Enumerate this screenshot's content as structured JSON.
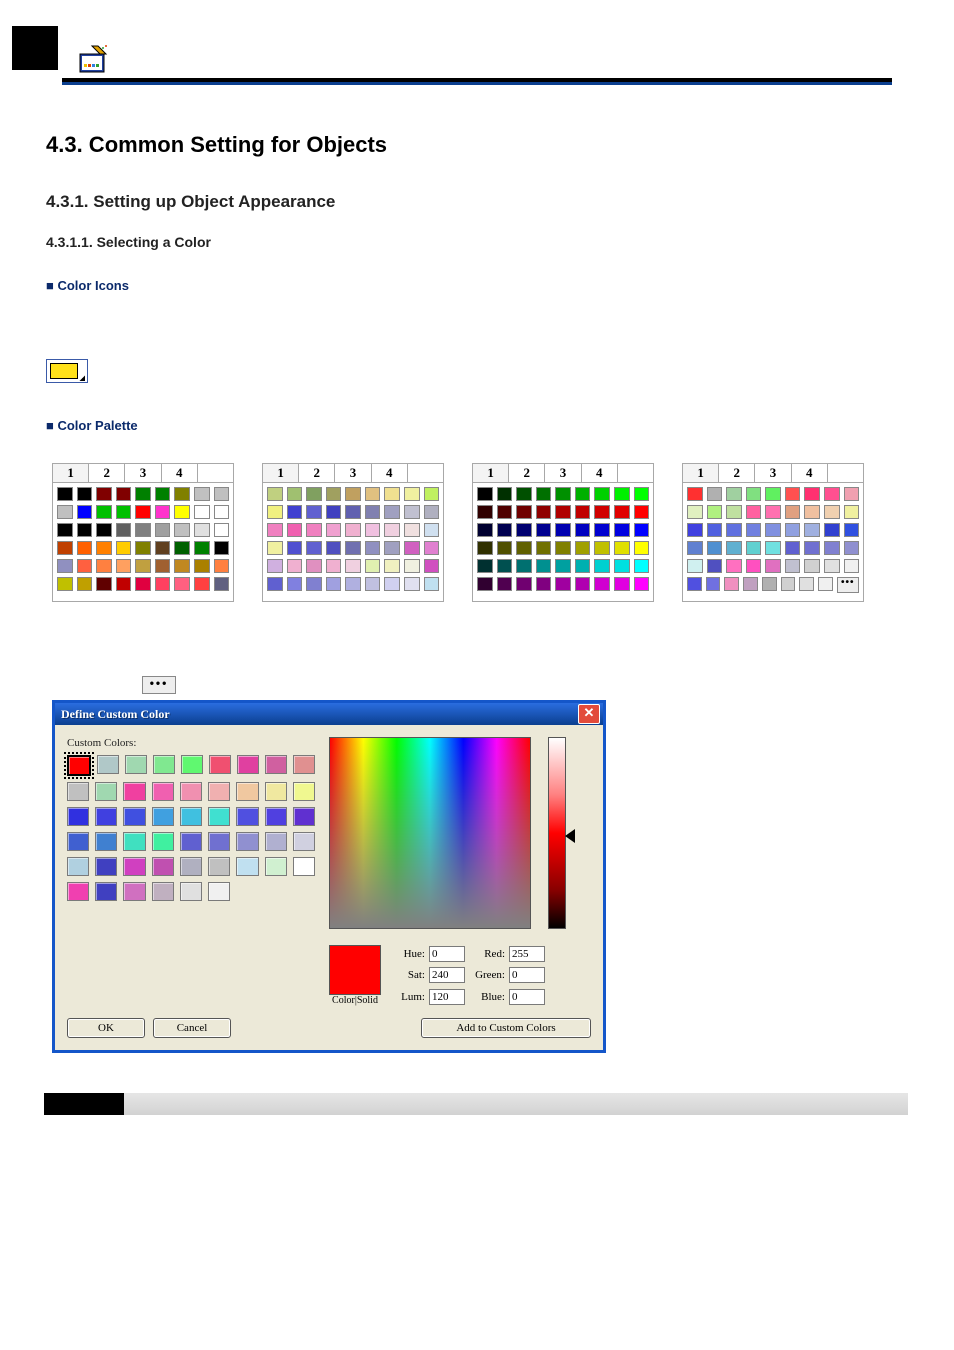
{
  "headings": {
    "h1": "4.3.   Common Setting for Objects",
    "h2": "4.3.1. Setting up Object Appearance",
    "h3": "4.3.1.1.  Selecting a Color",
    "b1": "■ Color Icons",
    "b2": "■ Color Palette"
  },
  "tabs": [
    "1",
    "2",
    "3",
    "4"
  ],
  "more": "•••",
  "palette1": [
    [
      "#000",
      "#000",
      "#800000",
      "#800000",
      "#008000",
      "#008000",
      "#808000",
      "#c0c0c0",
      "#c0c0c0"
    ],
    [
      "#c0c0c0",
      "#0000ff",
      "#00c000",
      "#00c000",
      "#ff0000",
      "#ff33cc",
      "#ffff00",
      "#ffffff",
      "#ffffff"
    ],
    [
      "#000",
      "#000",
      "#000",
      "#606060",
      "#808080",
      "#a0a0a0",
      "#c0c0c0",
      "#e0e0e0",
      "#ffffff"
    ],
    [
      "#c04000",
      "#ff6000",
      "#ff8000",
      "#ffcc00",
      "#808000",
      "#604020",
      "#006000",
      "#008000",
      "#000"
    ],
    [
      "#9090c0",
      "#ff6040",
      "#ff8040",
      "#ffa060",
      "#c0a040",
      "#a06030",
      "#c08820",
      "#aa8000",
      "#ff8040"
    ],
    [
      "#c0c000",
      "#c0a000",
      "#600000",
      "#c00000",
      "#e00040",
      "#ff4060",
      "#ff6080",
      "#ff4040",
      "#606080"
    ]
  ],
  "palette2": [
    [
      "#c0d080",
      "#a0c070",
      "#80a060",
      "#a0a060",
      "#c0a060",
      "#e0c080",
      "#f0e090",
      "#f0f0a0",
      "#c0f060"
    ],
    [
      "#f0f080",
      "#4040d0",
      "#6060d0",
      "#4040c0",
      "#6060b0",
      "#8080b0",
      "#a0a0c0",
      "#c0c0d0",
      "#b0b0c0"
    ],
    [
      "#f080c0",
      "#f060b0",
      "#f080c0",
      "#f0a0d0",
      "#f0b0d0",
      "#f0c0e0",
      "#f0d0e0",
      "#f0e0e0",
      "#d0e0f0"
    ],
    [
      "#f0f0a0",
      "#5050d0",
      "#6060d0",
      "#5050c0",
      "#7070b0",
      "#9090c0",
      "#a0a0c0",
      "#d060c0",
      "#e080d0"
    ],
    [
      "#d0b0e0",
      "#f0b0d0",
      "#e090c0",
      "#f0b0d0",
      "#f0d0e0",
      "#e0f0b0",
      "#f0f0c0",
      "#f0f0e0",
      "#d050c0"
    ],
    [
      "#6060d0",
      "#8080e0",
      "#8080d0",
      "#a0a0e0",
      "#b0b0e0",
      "#c0c0e0",
      "#d0d0f0",
      "#e0e0f0",
      "#c0e0f0"
    ]
  ],
  "palette3": [
    [
      "#000",
      "#003000",
      "#005000",
      "#007000",
      "#009000",
      "#00b000",
      "#00d000",
      "#00f000",
      "#00ff00"
    ],
    [
      "#300000",
      "#500000",
      "#700000",
      "#900000",
      "#b00000",
      "#c00000",
      "#d00000",
      "#e00000",
      "#ff0000"
    ],
    [
      "#000030",
      "#000050",
      "#000070",
      "#000090",
      "#0000b0",
      "#0000c0",
      "#0000d0",
      "#0000e0",
      "#0000ff"
    ],
    [
      "#303000",
      "#505000",
      "#606000",
      "#707000",
      "#808000",
      "#a0a000",
      "#c0c000",
      "#e0e000",
      "#ffff00"
    ],
    [
      "#003030",
      "#005050",
      "#007070",
      "#009090",
      "#00a0a0",
      "#00b0b0",
      "#00d0d0",
      "#00e0e0",
      "#00ffff"
    ],
    [
      "#300030",
      "#500050",
      "#700070",
      "#800080",
      "#a000a0",
      "#b000b0",
      "#d000d0",
      "#e000e0",
      "#ff00ff"
    ]
  ],
  "palette4": [
    [
      "#ff3030",
      "#b0b0b0",
      "#a0d0a0",
      "#80e080",
      "#60f060",
      "#ff5050",
      "#ff3070",
      "#ff5090",
      "#f0a0b0"
    ],
    [
      "#e0f0c0",
      "#b0f080",
      "#c0e0a0",
      "#ff60a0",
      "#ff70b0",
      "#e0a080",
      "#f0c0a0",
      "#f0d0b0",
      "#f0f0a0"
    ],
    [
      "#4040e0",
      "#5060e0",
      "#6070e0",
      "#7080e0",
      "#8090e0",
      "#90a0e0",
      "#a0b0e0",
      "#3040d0",
      "#3050e0"
    ],
    [
      "#6080d0",
      "#5090d0",
      "#60b0d0",
      "#60d0d0",
      "#70e0e0",
      "#6060d0",
      "#7070d0",
      "#8080d0",
      "#9090d0"
    ],
    [
      "#d0f0f0",
      "#5050c0",
      "#ff70c0",
      "#ff50c0",
      "#e070c0",
      "#c0c0d0",
      "#d0d0d0",
      "#e0e0e0",
      "#f0f0f0"
    ],
    [
      "#5050e0",
      "#7070e0",
      "#f090c0",
      "#c0a0c0",
      "#b0b0b0",
      "#d0d0d0",
      "#e0e0e0",
      "#f0f0f0",
      "MORE"
    ]
  ],
  "dialog": {
    "title": "Define Custom Color",
    "cc_label": "Custom Colors:",
    "colorsolid": "Color|Solid",
    "hue_l": "Hue:",
    "sat_l": "Sat:",
    "lum_l": "Lum:",
    "red_l": "Red:",
    "green_l": "Green:",
    "blue_l": "Blue:",
    "hue": "0",
    "sat": "240",
    "lum": "120",
    "red": "255",
    "green": "0",
    "blue": "0",
    "ok": "OK",
    "cancel": "Cancel",
    "add": "Add to Custom Colors",
    "grid": [
      [
        "#ff0000",
        "#b0c8c8",
        "#a0d8b0",
        "#80e890",
        "#60f870",
        "#f05070",
        "#e040a0",
        "#d060a0",
        "#e09090"
      ],
      [
        "#c0c0c0",
        "#a0d8b0",
        "#f040a0",
        "#f060b0",
        "#f090b0",
        "#f0b0b0",
        "#f0c8a0",
        "#f0e8a0",
        "#f0f890"
      ],
      [
        "#3030e0",
        "#4040e0",
        "#4050e0",
        "#40a0e0",
        "#40c0e0",
        "#40e0d0",
        "#5050e0",
        "#5040e0",
        "#6030d0"
      ],
      [
        "#4060d0",
        "#4080d0",
        "#40e0c0",
        "#40f0a0",
        "#6060d0",
        "#7070d0",
        "#9090d0",
        "#b0b0d0",
        "#d0d0e0"
      ],
      [
        "#b0d0e0",
        "#4040c0",
        "#d040c0",
        "#c050b0",
        "#b0b0c0",
        "#c0c0c0",
        "#c0e0f0",
        "#d0f0d0",
        "#ffffff"
      ],
      [
        "#f040b0",
        "#4040c0",
        "#d070c0",
        "#c0b0c0",
        "#e0e0e0",
        "#f0f0f0",
        "",
        "",
        ""
      ]
    ]
  }
}
